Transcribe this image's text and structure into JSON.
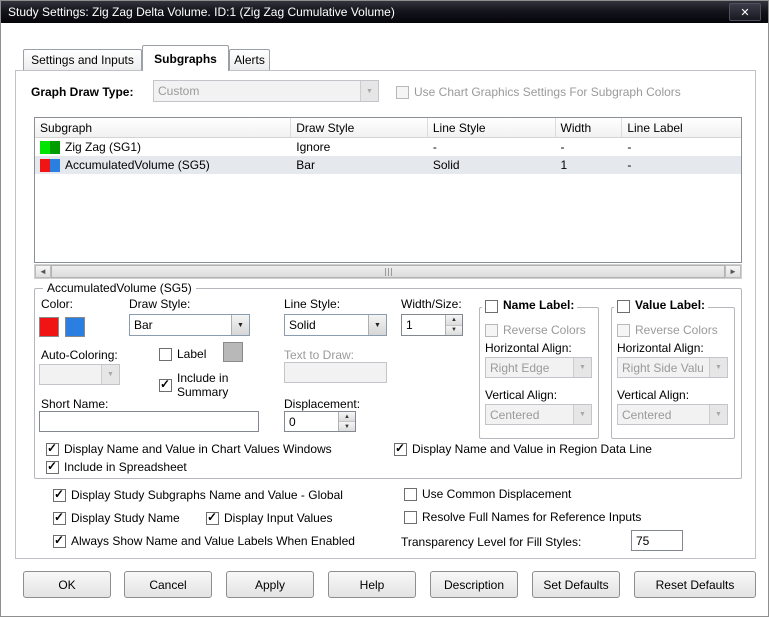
{
  "icons": {
    "close": "✕",
    "dropdown": "▼",
    "up": "▲",
    "down": "▼",
    "scroll_left": "◄",
    "scroll_right": "►",
    "check": "✓"
  },
  "window": {
    "title": "Study Settings: Zig Zag Delta Volume. ID:1 (Zig Zag Cumulative Volume)"
  },
  "tabs": {
    "settings_and_inputs": "Settings and Inputs",
    "subgraphs": "Subgraphs",
    "alerts": "Alerts"
  },
  "graph_draw_type": {
    "label": "Graph Draw Type:",
    "value": "Custom",
    "use_chart_graphics_label": "Use Chart Graphics Settings For Subgraph Colors"
  },
  "subgraph_table": {
    "headers": [
      "Subgraph",
      "Draw Style",
      "Line Style",
      "Width",
      "Line Label"
    ],
    "rows": [
      {
        "name": "Zig Zag (SG1)",
        "draw_style": "Ignore",
        "line_style": "-",
        "width": "-",
        "line_label": "-",
        "color1": "#00e400",
        "color2": "#009c00"
      },
      {
        "name": "AccumulatedVolume (SG5)",
        "draw_style": "Bar",
        "line_style": "Solid",
        "width": "1",
        "line_label": "-",
        "color1": "#f01414",
        "color2": "#2b7fe0"
      }
    ]
  },
  "subgraph_section": {
    "title": "AccumulatedVolume (SG5)",
    "color_label": "Color:",
    "primary_color": "#f01414",
    "secondary_color": "#2b7fe0",
    "label_color": "#b8b8b8",
    "draw_style_label": "Draw Style:",
    "draw_style_value": "Bar",
    "line_style_label": "Line Style:",
    "line_style_value": "Solid",
    "width_size_label": "Width/Size:",
    "width_size_value": "1",
    "auto_coloring_label": "Auto-Coloring:",
    "auto_coloring_value": "",
    "label_checkbox_label": "Label",
    "include_in_summary_label": "Include in Summary",
    "text_to_draw_label": "Text to Draw:",
    "text_to_draw_value": "",
    "short_name_label": "Short Name:",
    "short_name_value": "",
    "displacement_label": "Displacement:",
    "displacement_value": "0",
    "name_label": {
      "title": "Name Label:",
      "reverse_colors_label": "Reverse Colors",
      "horizontal_align_label": "Horizontal Align:",
      "horizontal_align_value": "Right Edge",
      "vertical_align_label": "Vertical Align:",
      "vertical_align_value": "Centered"
    },
    "value_label": {
      "title": "Value Label:",
      "reverse_colors_label": "Reverse Colors",
      "horizontal_align_label": "Horizontal Align:",
      "horizontal_align_value": "Right Side Valu",
      "vertical_align_label": "Vertical Align:",
      "vertical_align_value": "Centered"
    },
    "display_chart_values_label": "Display Name and Value in Chart Values Windows",
    "display_region_data_label": "Display Name and Value in Region Data Line",
    "include_spreadsheet_label": "Include in Spreadsheet"
  },
  "global_options": {
    "subgraphs_global_label": "Display Study Subgraphs Name and Value - Global",
    "common_displacement_label": "Use Common Displacement",
    "display_study_name_label": "Display Study Name",
    "display_input_values_label": "Display Input Values",
    "resolve_full_names_label": "Resolve Full Names for Reference Inputs",
    "always_show_label": "Always Show Name and Value Labels When Enabled",
    "transparency_label": "Transparency Level for Fill Styles:",
    "transparency_value": "75"
  },
  "buttons": {
    "ok": "OK",
    "cancel": "Cancel",
    "apply": "Apply",
    "help": "Help",
    "description": "Description",
    "set_defaults": "Set Defaults",
    "reset_defaults": "Reset Defaults"
  }
}
